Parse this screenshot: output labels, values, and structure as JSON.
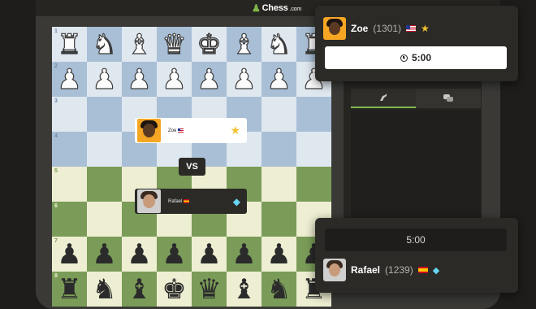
{
  "app": {
    "logo_text": "Chess",
    "logo_suffix": ".com"
  },
  "board": {
    "ranks": [
      {
        "label": "1",
        "pieces": [
          {
            "c": "w",
            "p": "♜"
          },
          {
            "c": "w",
            "p": "♞"
          },
          {
            "c": "w",
            "p": "♝"
          },
          {
            "c": "w",
            "p": "♛"
          },
          {
            "c": "w",
            "p": "♚"
          },
          {
            "c": "w",
            "p": "♝"
          },
          {
            "c": "w",
            "p": "♞"
          },
          {
            "c": "w",
            "p": "♜"
          }
        ]
      },
      {
        "label": "2",
        "pieces": [
          {
            "c": "w",
            "p": "♟"
          },
          {
            "c": "w",
            "p": "♟"
          },
          {
            "c": "w",
            "p": "♟"
          },
          {
            "c": "w",
            "p": "♟"
          },
          {
            "c": "w",
            "p": "♟"
          },
          {
            "c": "w",
            "p": "♟"
          },
          {
            "c": "w",
            "p": "♟"
          },
          {
            "c": "w",
            "p": "♟"
          }
        ]
      },
      {
        "label": "3",
        "pieces": []
      },
      {
        "label": "4",
        "pieces": []
      },
      {
        "label": "5",
        "pieces": []
      },
      {
        "label": "6",
        "pieces": []
      },
      {
        "label": "7",
        "pieces": [
          {
            "c": "b",
            "p": "♟"
          },
          {
            "c": "b",
            "p": "♟"
          },
          {
            "c": "b",
            "p": "♟"
          },
          {
            "c": "b",
            "p": "♟"
          },
          {
            "c": "b",
            "p": "♟"
          },
          {
            "c": "b",
            "p": "♟"
          },
          {
            "c": "b",
            "p": "♟"
          },
          {
            "c": "b",
            "p": "♟"
          }
        ]
      },
      {
        "label": "8",
        "pieces": [
          {
            "c": "b",
            "p": "♜"
          },
          {
            "c": "b",
            "p": "♞"
          },
          {
            "c": "b",
            "p": "♝"
          },
          {
            "c": "b",
            "p": "♚"
          },
          {
            "c": "b",
            "p": "♛"
          },
          {
            "c": "b",
            "p": "♝"
          },
          {
            "c": "b",
            "p": "♞"
          },
          {
            "c": "b",
            "p": "♜"
          }
        ]
      }
    ],
    "vs_label": "VS",
    "zoe_card": {
      "name": "Zoe",
      "flag": "us-flag-icon",
      "badge": "star-icon"
    },
    "rafael_card": {
      "name": "Rafael",
      "flag": "es-flag-icon",
      "badge": "diamond-icon"
    }
  },
  "top_player": {
    "name": "Zoe",
    "rating": "(1301)",
    "flag": "us-flag-icon",
    "badge": "star-icon",
    "clock": "5:00"
  },
  "bottom_player": {
    "name": "Rafael",
    "rating": "(1239)",
    "flag": "es-flag-icon",
    "badge": "diamond-icon",
    "clock": "5:00"
  },
  "side_panel": {
    "tabs": [
      {
        "icon": "move-list-icon",
        "active": true
      },
      {
        "icon": "chat-icon",
        "active": false
      }
    ]
  },
  "colors": {
    "accent": "#81b64c",
    "board_light_top": "#dfe7ef",
    "board_dark_top": "#a9bfd6",
    "board_light_bottom": "#eeeed2",
    "board_dark_bottom": "#7a9c58"
  }
}
